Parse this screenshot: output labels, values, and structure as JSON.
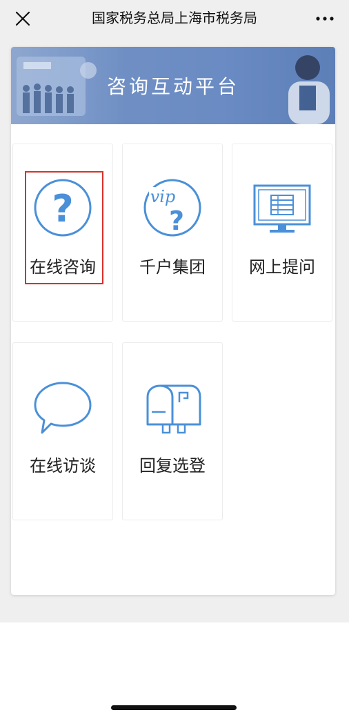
{
  "topbar": {
    "title": "国家税务总局上海市税务局",
    "close_icon": "close-icon",
    "more_icon": "more-icon"
  },
  "banner": {
    "title": "咨询互动平台"
  },
  "tiles": [
    {
      "label": "在线咨询",
      "icon": "question-circle-icon"
    },
    {
      "label": "千户集团",
      "icon": "vip-question-icon"
    },
    {
      "label": "网上提问",
      "icon": "monitor-icon"
    },
    {
      "label": "在线访谈",
      "icon": "speech-bubble-icon"
    },
    {
      "label": "回复选登",
      "icon": "mailbox-icon"
    }
  ],
  "colors": {
    "icon_blue": "#4a90d9",
    "highlight_red": "#d9302a",
    "banner_blue": "#6a8bc3"
  }
}
